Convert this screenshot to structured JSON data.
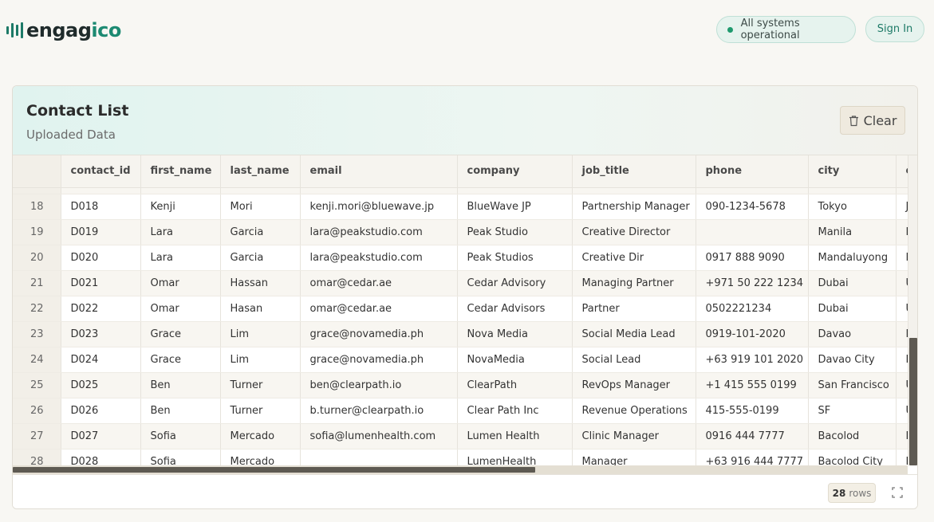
{
  "header": {
    "logo_prefix": "engag",
    "logo_suffix": "ico",
    "status_text": "All systems operational",
    "signin_label": "Sign In"
  },
  "card": {
    "title": "Contact List",
    "subtitle": "Uploaded Data",
    "clear_label": "Clear"
  },
  "table": {
    "columns": [
      "",
      "contact_id",
      "first_name",
      "last_name",
      "email",
      "company",
      "job_title",
      "phone",
      "city",
      "c"
    ],
    "rows": [
      [
        "18",
        "D018",
        "Kenji",
        "Mori",
        "kenji.mori@bluewave.jp",
        "BlueWave JP",
        "Partnership Manager",
        "090-1234-5678",
        "Tokyo",
        "J"
      ],
      [
        "19",
        "D019",
        "Lara",
        "Garcia",
        "lara@peakstudio.com",
        "Peak Studio",
        "Creative Director",
        "",
        "Manila",
        "P"
      ],
      [
        "20",
        "D020",
        "Lara",
        "Garcia",
        "lara@peakstudio.com",
        "Peak Studios",
        "Creative Dir",
        "0917 888 9090",
        "Mandaluyong",
        "P"
      ],
      [
        "21",
        "D021",
        "Omar",
        "Hassan",
        "omar@cedar.ae",
        "Cedar Advisory",
        "Managing Partner",
        "+971 50 222 1234",
        "Dubai",
        "U"
      ],
      [
        "22",
        "D022",
        "Omar",
        "Hasan",
        "omar@cedar.ae",
        "Cedar Advisors",
        "Partner",
        "0502221234",
        "Dubai",
        "U"
      ],
      [
        "23",
        "D023",
        "Grace",
        "Lim",
        "grace@novamedia.ph",
        "Nova Media",
        "Social Media Lead",
        "0919-101-2020",
        "Davao",
        "P"
      ],
      [
        "24",
        "D024",
        "Grace",
        "Lim",
        "grace@novamedia.ph",
        "NovaMedia",
        "Social Lead",
        "+63 919 101 2020",
        "Davao City",
        "P"
      ],
      [
        "25",
        "D025",
        "Ben",
        "Turner",
        "ben@clearpath.io",
        "ClearPath",
        "RevOps Manager",
        "+1 415 555 0199",
        "San Francisco",
        "U"
      ],
      [
        "26",
        "D026",
        "Ben",
        "Turner",
        "b.turner@clearpath.io",
        "Clear Path Inc",
        "Revenue Operations",
        "415-555-0199",
        "SF",
        "U"
      ],
      [
        "27",
        "D027",
        "Sofia",
        "Mercado",
        "sofia@lumenhealth.com",
        "Lumen Health",
        "Clinic Manager",
        "0916 444 7777",
        "Bacolod",
        "P"
      ],
      [
        "28",
        "D028",
        "Sofia",
        "Mercado",
        "",
        "LumenHealth",
        "Manager",
        "+63 916 444 7777",
        "Bacolod City",
        "P"
      ]
    ]
  },
  "footer": {
    "row_count": "28",
    "row_unit": "rows"
  },
  "icons": {
    "clear": "trash-icon",
    "expand": "fullscreen-icon",
    "status": "status-dot"
  },
  "colors": {
    "brand": "#1d8a72",
    "status_green": "#1f9a6e",
    "scroll_thumb": "#5e5a52"
  }
}
